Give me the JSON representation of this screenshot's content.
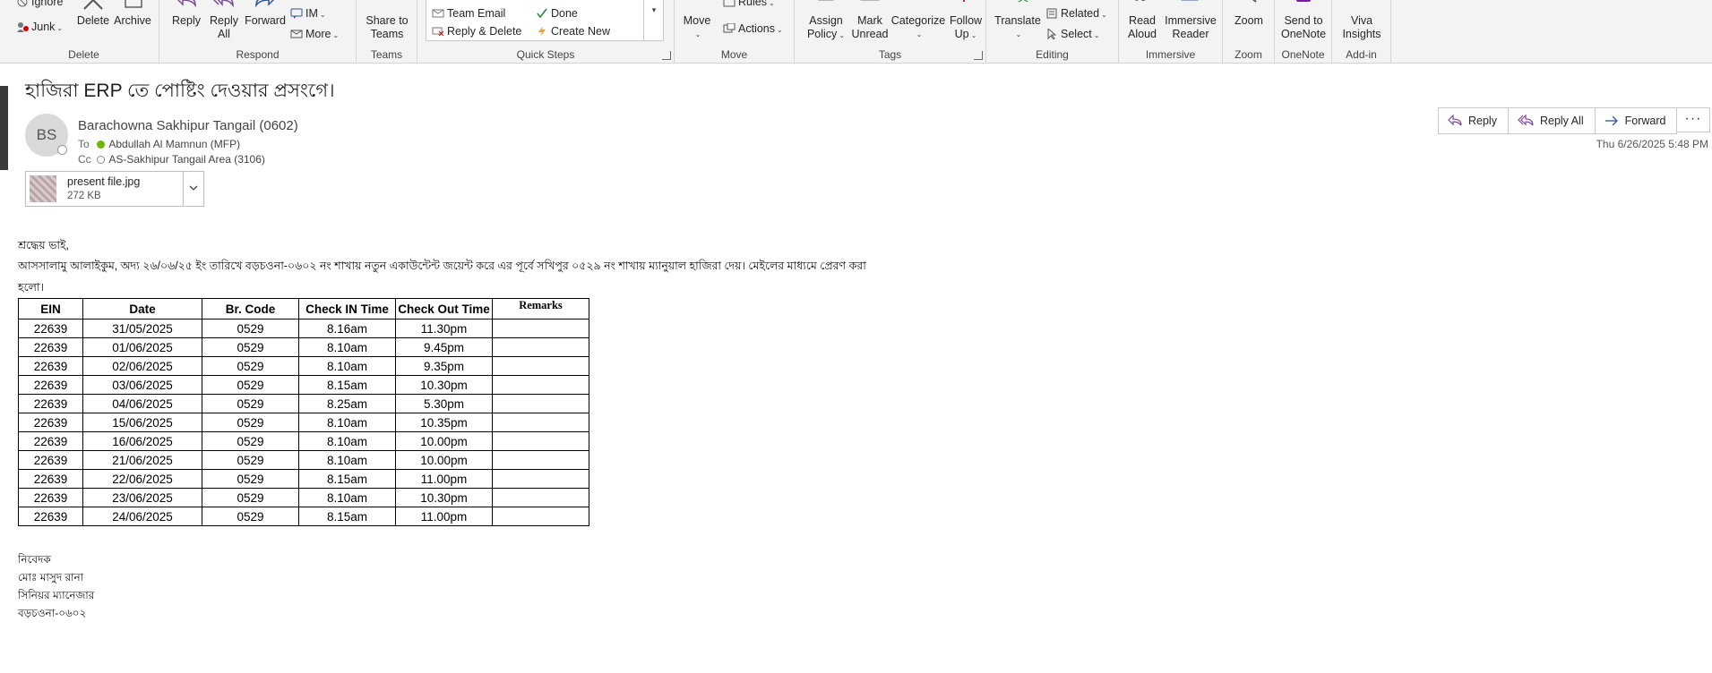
{
  "ribbon": {
    "delete_group": {
      "label": "Delete",
      "ignore": "Ignore",
      "junk": "Junk",
      "delete": "Delete",
      "archive": "Archive"
    },
    "respond_group": {
      "label": "Respond",
      "reply": "Reply",
      "reply_all_1": "Reply",
      "reply_all_2": "All",
      "forward": "Forward",
      "im": "IM",
      "more": "More"
    },
    "teams_group": {
      "label": "Teams",
      "share_1": "Share to",
      "share_2": "Teams"
    },
    "quick_steps_group": {
      "label": "Quick Steps",
      "team_email": "Team Email",
      "reply_delete": "Reply & Delete",
      "done": "Done",
      "create_new": "Create New"
    },
    "move_group": {
      "label": "Move",
      "move": "Move",
      "rules": "Rules",
      "actions": "Actions"
    },
    "tags_group": {
      "label": "Tags",
      "assign_1": "Assign",
      "assign_2": "Policy",
      "mark_1": "Mark",
      "mark_2": "Unread",
      "categorize": "Categorize",
      "follow_1": "Follow",
      "follow_2": "Up"
    },
    "editing_group": {
      "label": "Editing",
      "translate": "Translate",
      "related": "Related",
      "select": "Select"
    },
    "immersive_group": {
      "label": "Immersive",
      "read_1": "Read",
      "read_2": "Aloud",
      "reader_1": "Immersive",
      "reader_2": "Reader"
    },
    "zoom_group": {
      "label": "Zoom",
      "zoom": "Zoom"
    },
    "onenote_group": {
      "label": "OneNote",
      "send_1": "Send to",
      "send_2": "OneNote"
    },
    "addin_group": {
      "label": "Add-in",
      "viva_1": "Viva",
      "viva_2": "Insights"
    }
  },
  "message": {
    "subject": "হাজিরা ERP তে পোষ্টিং দেওয়ার প্রসংগে।",
    "avatar_initials": "BS",
    "sender": "Barachowna Sakhipur Tangail (0602)",
    "to_label": "To",
    "to": "Abdullah Al Mamnun (MFP)",
    "cc_label": "Cc",
    "cc": "AS-Sakhipur Tangail Area (3106)",
    "date": "Thu 6/26/2025 5:48 PM",
    "actions": {
      "reply": "Reply",
      "reply_all": "Reply All",
      "forward": "Forward",
      "more": "···"
    },
    "attachment": {
      "name": "present file.jpg",
      "size": "272 KB"
    }
  },
  "body": {
    "greeting": "শ্রদ্ধেয় ভাই,",
    "paragraph_line1": "আসসালামু আলাইকুম, অদ্য ২৬/০৬/২৫ ইং তারিখে বড়চওনা-০৬০২  নং শাখায় নতুন একাউন্টেন্ট জয়েন্ট করে এর পূর্বে সখিপুর ০৫২৯ নং শাখায় ম্যানুয়াল হাজিরা দেয়। মেইলের  মাধ্যমে প্রেরণ করা",
    "paragraph_line2": " হলো।",
    "table": {
      "headers": [
        "EIN",
        "Date",
        "Br. Code",
        "Check IN Time",
        "Check Out Time",
        "Remarks"
      ],
      "rows": [
        [
          "22639",
          "31/05/2025",
          "0529",
          "8.16am",
          "11.30pm",
          ""
        ],
        [
          "22639",
          "01/06/2025",
          "0529",
          "8.10am",
          "9.45pm",
          ""
        ],
        [
          "22639",
          "02/06/2025",
          "0529",
          "8.10am",
          "9.35pm",
          ""
        ],
        [
          "22639",
          "03/06/2025",
          "0529",
          "8.15am",
          "10.30pm",
          ""
        ],
        [
          "22639",
          "04/06/2025",
          "0529",
          "8.25am",
          "5.30pm",
          ""
        ],
        [
          "22639",
          "15/06/2025",
          "0529",
          "8.10am",
          "10.35pm",
          ""
        ],
        [
          "22639",
          "16/06/2025",
          "0529",
          "8.10am",
          "10.00pm",
          ""
        ],
        [
          "22639",
          "21/06/2025",
          "0529",
          "8.10am",
          "10.00pm",
          ""
        ],
        [
          "22639",
          "22/06/2025",
          "0529",
          "8.15am",
          "11.00pm",
          ""
        ],
        [
          "22639",
          "23/06/2025",
          "0529",
          "8.10am",
          "10.30pm",
          ""
        ],
        [
          "22639",
          "24/06/2025",
          "0529",
          "8.15am",
          "11.00pm",
          ""
        ]
      ]
    },
    "signature": [
      "নিবেদক",
      "মোঃ মাসুদ রানা",
      "সিনিয়র ম্যানেজার",
      "বড়চওনা-০৬০২"
    ]
  },
  "colors": {
    "accent": "#2b579a",
    "onenote": "#7719aa",
    "presence_available": "#6bb700"
  }
}
